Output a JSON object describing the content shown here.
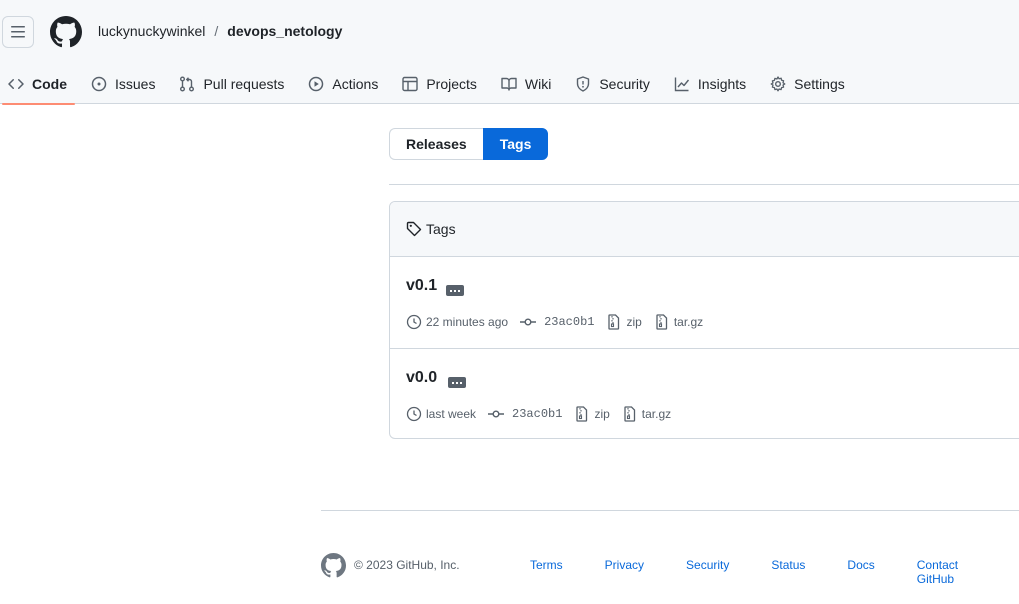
{
  "header": {
    "owner": "luckynuckywinkel",
    "separator": "/",
    "repo": "devops_netology"
  },
  "tabs": [
    {
      "label": "Code"
    },
    {
      "label": "Issues"
    },
    {
      "label": "Pull requests"
    },
    {
      "label": "Actions"
    },
    {
      "label": "Projects"
    },
    {
      "label": "Wiki"
    },
    {
      "label": "Security"
    },
    {
      "label": "Insights"
    },
    {
      "label": "Settings"
    }
  ],
  "subnav": {
    "releases": "Releases",
    "tags": "Tags"
  },
  "box": {
    "title": "Tags"
  },
  "tags": [
    {
      "name": "v0.1",
      "time": "22 minutes ago",
      "sha": "23ac0b1",
      "zip": "zip",
      "targz": "tar.gz"
    },
    {
      "name": "v0.0",
      "time": "last week",
      "sha": "23ac0b1",
      "zip": "zip",
      "targz": "tar.gz"
    }
  ],
  "footer": {
    "copyright": "© 2023 GitHub, Inc.",
    "links": [
      "Terms",
      "Privacy",
      "Security",
      "Status",
      "Docs",
      "Contact GitHub"
    ]
  },
  "colors": {
    "accent": "#0969da",
    "tab_underline": "#fd8c73"
  }
}
